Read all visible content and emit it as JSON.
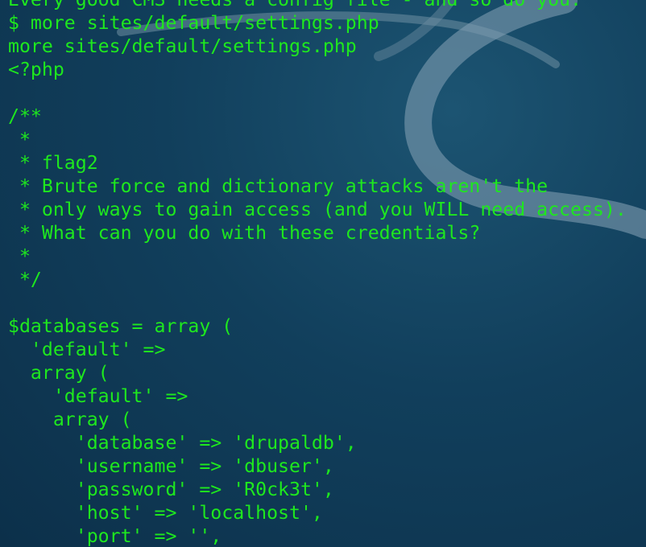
{
  "terminal": {
    "text_color": "#1ee81e",
    "background_color": "#0f3a55",
    "lines": [
      "Every good CMS needs a config file - and so do you.",
      "$ more sites/default/settings.php",
      "more sites/default/settings.php",
      "<?php",
      "",
      "/**",
      " *",
      " * flag2",
      " * Brute force and dictionary attacks aren't the",
      " * only ways to gain access (and you WILL need access).",
      " * What can you do with these credentials?",
      " *",
      " */",
      "",
      "$databases = array (",
      "  'default' =>",
      "  array (",
      "    'default' =>",
      "    array (",
      "      'database' => 'drupaldb',",
      "      'username' => 'dbuser',",
      "      'password' => 'R0ck3t',",
      "      'host' => 'localhost',",
      "      'port' => '',"
    ]
  }
}
